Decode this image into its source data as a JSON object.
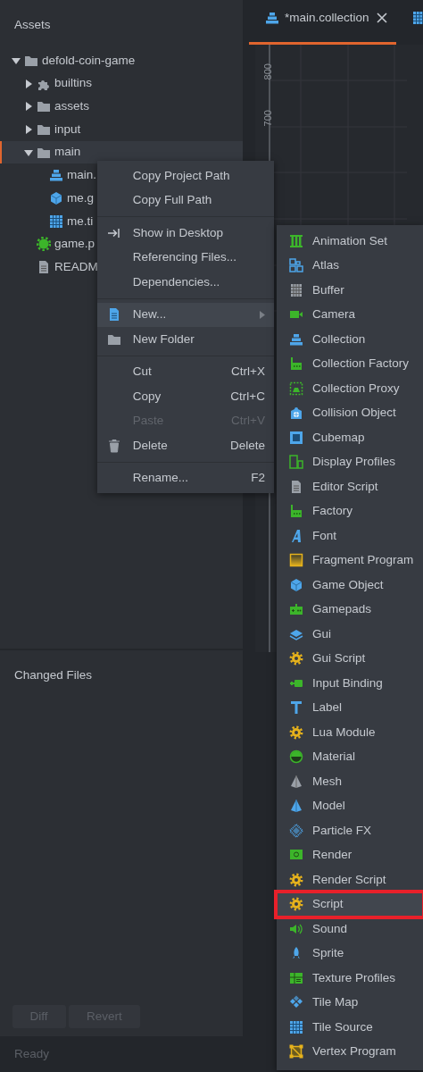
{
  "assets_panel": {
    "title": "Assets",
    "tree": [
      {
        "label": "defold-coin-game",
        "kind": "folder",
        "expanded": true,
        "selected": false,
        "children": [
          {
            "label": "builtins",
            "kind": "puzzle",
            "expanded": false,
            "selected": false
          },
          {
            "label": "assets",
            "kind": "folder",
            "expanded": false,
            "selected": false
          },
          {
            "label": "input",
            "kind": "folder",
            "expanded": false,
            "selected": false
          },
          {
            "label": "main",
            "kind": "folder",
            "expanded": true,
            "selected": true,
            "children": [
              {
                "label": "main.",
                "kind": "collection",
                "selected": false
              },
              {
                "label": "me.g",
                "kind": "cube",
                "selected": false
              },
              {
                "label": "me.ti",
                "kind": "grid",
                "selected": false
              }
            ]
          },
          {
            "label": "game.p",
            "kind": "project",
            "selected": false
          },
          {
            "label": "READM",
            "kind": "file",
            "selected": false
          }
        ]
      }
    ]
  },
  "editor": {
    "tabs": [
      {
        "label": "*main.collection",
        "kind": "collection",
        "selected": true,
        "closable": true
      },
      {
        "kind": "grid",
        "selected": false,
        "closable": false
      }
    ],
    "ruler_labels": [
      "800",
      "700"
    ]
  },
  "context_menu": {
    "items": [
      {
        "kind": "plain",
        "label": "Copy Project Path",
        "disabled": false,
        "highlighted": false
      },
      {
        "kind": "plain",
        "label": "Copy Full Path",
        "disabled": false,
        "highlighted": false
      },
      {
        "kind": "separator"
      },
      {
        "kind": "reveal",
        "label": "Show in Desktop",
        "disabled": false,
        "highlighted": false
      },
      {
        "kind": "plain",
        "label": "Referencing Files...",
        "disabled": false,
        "highlighted": false
      },
      {
        "kind": "plain",
        "label": "Dependencies...",
        "disabled": false,
        "highlighted": false
      },
      {
        "kind": "separator"
      },
      {
        "kind": "doc",
        "label": "New...",
        "disabled": false,
        "highlighted": true,
        "submenu": true
      },
      {
        "kind": "folder",
        "label": "New Folder",
        "disabled": false,
        "highlighted": false
      },
      {
        "kind": "separator"
      },
      {
        "kind": "plain",
        "label": "Cut",
        "shortcut": "Ctrl+X",
        "disabled": false,
        "highlighted": false
      },
      {
        "kind": "plain",
        "label": "Copy",
        "shortcut": "Ctrl+C",
        "disabled": false,
        "highlighted": false
      },
      {
        "kind": "plain",
        "label": "Paste",
        "shortcut": "Ctrl+V",
        "disabled": true,
        "highlighted": false
      },
      {
        "kind": "trash",
        "label": "Delete",
        "shortcut": "Delete",
        "disabled": false,
        "highlighted": false
      },
      {
        "kind": "separator"
      },
      {
        "kind": "plain",
        "label": "Rename...",
        "shortcut": "F2",
        "disabled": false,
        "highlighted": false
      }
    ]
  },
  "new_submenu": {
    "items": [
      {
        "label": "Animation Set",
        "kind": "anim",
        "highlighted": false,
        "annotated": false
      },
      {
        "label": "Atlas",
        "kind": "atlas",
        "highlighted": false,
        "annotated": false
      },
      {
        "label": "Buffer",
        "kind": "buffer",
        "highlighted": false,
        "annotated": false
      },
      {
        "label": "Camera",
        "kind": "camera",
        "highlighted": false,
        "annotated": false
      },
      {
        "label": "Collection",
        "kind": "collection",
        "highlighted": false,
        "annotated": false
      },
      {
        "label": "Collection Factory",
        "kind": "factory",
        "highlighted": false,
        "annotated": false
      },
      {
        "label": "Collection Proxy",
        "kind": "proxy",
        "highlighted": false,
        "annotated": false
      },
      {
        "label": "Collision Object",
        "kind": "collision",
        "highlighted": false,
        "annotated": false
      },
      {
        "label": "Cubemap",
        "kind": "cubemap",
        "highlighted": false,
        "annotated": false
      },
      {
        "label": "Display Profiles",
        "kind": "display",
        "highlighted": false,
        "annotated": false
      },
      {
        "label": "Editor Script",
        "kind": "file",
        "highlighted": false,
        "annotated": false
      },
      {
        "label": "Factory",
        "kind": "factory",
        "highlighted": false,
        "annotated": false
      },
      {
        "label": "Font",
        "kind": "font",
        "highlighted": false,
        "annotated": false
      },
      {
        "label": "Fragment Program",
        "kind": "fragment",
        "highlighted": false,
        "annotated": false
      },
      {
        "label": "Game Object",
        "kind": "cube",
        "highlighted": false,
        "annotated": false
      },
      {
        "label": "Gamepads",
        "kind": "gamepad",
        "highlighted": false,
        "annotated": false
      },
      {
        "label": "Gui",
        "kind": "gui",
        "highlighted": false,
        "annotated": false
      },
      {
        "label": "Gui Script",
        "kind": "gear",
        "highlighted": false,
        "annotated": false
      },
      {
        "label": "Input Binding",
        "kind": "plug",
        "highlighted": false,
        "annotated": false
      },
      {
        "label": "Label",
        "kind": "label",
        "highlighted": false,
        "annotated": false
      },
      {
        "label": "Lua Module",
        "kind": "gear",
        "highlighted": false,
        "annotated": false
      },
      {
        "label": "Material",
        "kind": "material",
        "highlighted": false,
        "annotated": false
      },
      {
        "label": "Mesh",
        "kind": "mesh",
        "highlighted": false,
        "annotated": false
      },
      {
        "label": "Model",
        "kind": "model",
        "highlighted": false,
        "annotated": false
      },
      {
        "label": "Particle FX",
        "kind": "particle",
        "highlighted": false,
        "annotated": false
      },
      {
        "label": "Render",
        "kind": "render",
        "highlighted": false,
        "annotated": false
      },
      {
        "label": "Render Script",
        "kind": "gear",
        "highlighted": false,
        "annotated": false
      },
      {
        "label": "Script",
        "kind": "gear",
        "highlighted": true,
        "annotated": true
      },
      {
        "label": "Sound",
        "kind": "sound",
        "highlighted": false,
        "annotated": false
      },
      {
        "label": "Sprite",
        "kind": "sprite",
        "highlighted": false,
        "annotated": false
      },
      {
        "label": "Texture Profiles",
        "kind": "texture",
        "highlighted": false,
        "annotated": false
      },
      {
        "label": "Tile Map",
        "kind": "tilemap",
        "highlighted": false,
        "annotated": false
      },
      {
        "label": "Tile Source",
        "kind": "grid",
        "highlighted": false,
        "annotated": false
      },
      {
        "label": "Vertex Program",
        "kind": "vertex",
        "highlighted": false,
        "annotated": false
      }
    ]
  },
  "changed_files": {
    "title": "Changed Files",
    "buttons": [
      {
        "label": "Diff",
        "disabled": true
      },
      {
        "label": "Revert",
        "disabled": true
      }
    ]
  },
  "status_bar": {
    "text": "Ready"
  }
}
